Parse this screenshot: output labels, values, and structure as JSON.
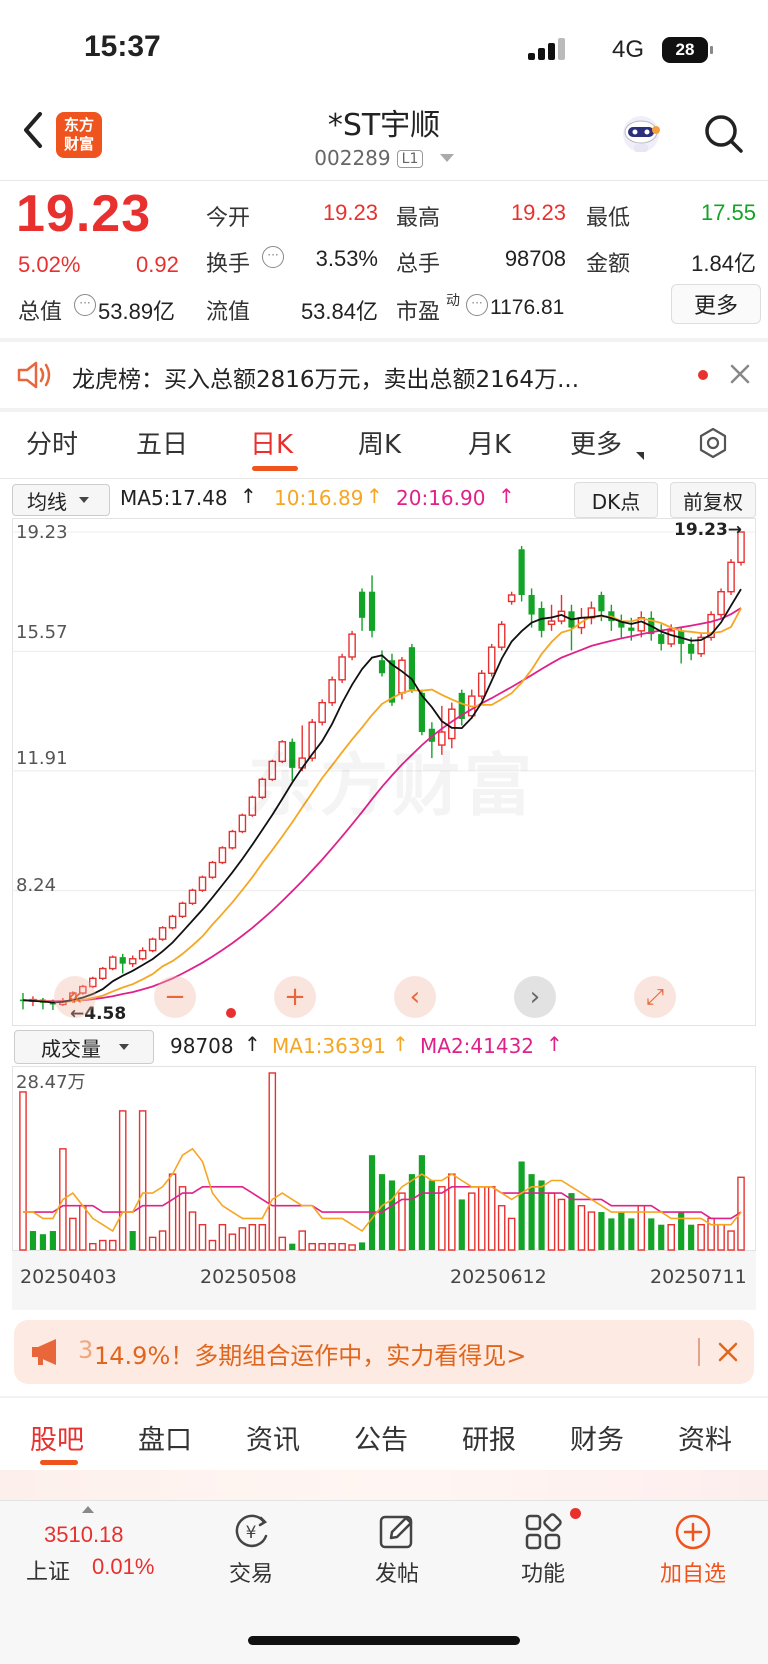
{
  "status_bar": {
    "time": "15:37",
    "network": "4G",
    "battery": "28"
  },
  "header": {
    "title": "*ST宇顺",
    "code": "002289",
    "level": "L1",
    "logo_line1": "东方",
    "logo_line2": "财富"
  },
  "quote": {
    "price": "19.23",
    "change_pct": "5.02%",
    "change_amt": "0.92",
    "open_label": "今开",
    "open": "19.23",
    "high_label": "最高",
    "high": "19.23",
    "low_label": "最低",
    "low": "17.55",
    "turnover_label": "换手",
    "turnover": "3.53%",
    "volume_label": "总手",
    "volume": "98708",
    "amount_label": "金额",
    "amount": "1.84亿",
    "mktcap_label": "总值",
    "mktcap": "53.89亿",
    "float_label": "流值",
    "float_cap": "53.84亿",
    "pe_label": "市盈",
    "pe_sup": "动",
    "pe": "1176.81",
    "more": "更多"
  },
  "notice": {
    "text": "龙虎榜：买入总额2816万元，卖出总额2164万..."
  },
  "period_tabs": [
    {
      "label": "分时"
    },
    {
      "label": "五日"
    },
    {
      "label": "日K"
    },
    {
      "label": "周K"
    },
    {
      "label": "月K"
    },
    {
      "label": "更多"
    }
  ],
  "chart_toolbar": {
    "indicator": "均线",
    "ma5": "MA5:17.48",
    "ma10": "10:16.89",
    "ma20": "20:16.90",
    "dk": "DK点",
    "adjust": "前复权"
  },
  "chart_data": [
    {
      "type": "candlestick",
      "y_ticks": [
        "19.23",
        "15.57",
        "11.91",
        "8.24"
      ],
      "ylim": [
        4.58,
        19.23
      ],
      "max_label": "19.23",
      "min_label": "4.58",
      "colors": {
        "up": "#e8312f",
        "down": "#13a327",
        "ma5": "#111111",
        "ma10": "#f5a623",
        "ma20": "#e0218a"
      },
      "candles": [
        [
          4.9,
          4.85,
          5.1,
          4.6
        ],
        [
          4.85,
          4.9,
          5.0,
          4.7
        ],
        [
          4.9,
          4.8,
          4.95,
          4.6
        ],
        [
          4.8,
          4.75,
          4.9,
          4.58
        ],
        [
          4.75,
          4.85,
          4.95,
          4.7
        ],
        [
          4.85,
          5.1,
          5.15,
          4.8
        ],
        [
          5.1,
          5.3,
          5.35,
          5.05
        ],
        [
          5.3,
          5.55,
          5.6,
          5.25
        ],
        [
          5.55,
          5.85,
          5.9,
          5.5
        ],
        [
          5.85,
          6.2,
          6.25,
          5.8
        ],
        [
          6.2,
          6.0,
          6.3,
          5.7
        ],
        [
          6.0,
          6.15,
          6.25,
          5.9
        ],
        [
          6.15,
          6.4,
          6.5,
          6.1
        ],
        [
          6.4,
          6.75,
          6.8,
          6.35
        ],
        [
          6.75,
          7.1,
          7.15,
          6.7
        ],
        [
          7.1,
          7.45,
          7.5,
          7.05
        ],
        [
          7.45,
          7.85,
          7.9,
          7.4
        ],
        [
          7.85,
          8.25,
          8.3,
          7.8
        ],
        [
          8.25,
          8.65,
          8.7,
          8.2
        ],
        [
          8.65,
          9.1,
          9.15,
          8.6
        ],
        [
          9.1,
          9.55,
          9.6,
          9.05
        ],
        [
          9.55,
          10.05,
          10.1,
          9.5
        ],
        [
          10.05,
          10.55,
          10.6,
          10.0
        ],
        [
          10.55,
          11.1,
          11.15,
          10.5
        ],
        [
          11.1,
          11.65,
          11.7,
          11.05
        ],
        [
          11.65,
          12.2,
          12.25,
          11.6
        ],
        [
          12.2,
          12.8,
          12.85,
          12.15
        ],
        [
          12.8,
          12.0,
          12.9,
          11.6
        ],
        [
          12.0,
          12.3,
          13.3,
          11.9
        ],
        [
          12.3,
          13.4,
          13.5,
          12.2
        ],
        [
          13.4,
          14.0,
          14.1,
          13.3
        ],
        [
          14.0,
          14.7,
          14.8,
          13.9
        ],
        [
          14.7,
          15.4,
          15.5,
          14.6
        ],
        [
          15.4,
          16.1,
          16.2,
          15.3
        ],
        [
          17.4,
          16.6,
          17.5,
          16.2
        ],
        [
          17.4,
          16.2,
          17.9,
          16.0
        ],
        [
          15.3,
          14.9,
          15.6,
          14.8
        ],
        [
          15.3,
          14.0,
          15.5,
          13.9
        ],
        [
          14.3,
          15.3,
          15.4,
          14.1
        ],
        [
          15.7,
          14.4,
          15.8,
          14.3
        ],
        [
          14.3,
          13.1,
          14.4,
          13.0
        ],
        [
          13.2,
          12.8,
          13.4,
          12.3
        ],
        [
          12.7,
          13.1,
          13.9,
          12.4
        ],
        [
          12.9,
          13.8,
          14.0,
          12.6
        ],
        [
          14.3,
          13.5,
          14.4,
          13.3
        ],
        [
          13.6,
          14.2,
          14.4,
          13.5
        ],
        [
          14.2,
          14.9,
          15.0,
          14.1
        ],
        [
          14.9,
          15.7,
          15.8,
          14.8
        ],
        [
          15.7,
          16.4,
          16.5,
          15.6
        ],
        [
          17.1,
          17.3,
          17.4,
          17.0
        ],
        [
          18.7,
          17.3,
          18.8,
          17.1
        ],
        [
          17.3,
          16.7,
          17.5,
          16.3
        ],
        [
          16.9,
          16.2,
          17.1,
          16.0
        ],
        [
          16.4,
          16.5,
          17.0,
          16.2
        ],
        [
          16.5,
          16.8,
          17.3,
          16.4
        ],
        [
          16.8,
          16.3,
          17.0,
          15.6
        ],
        [
          16.3,
          16.6,
          16.9,
          16.1
        ],
        [
          16.6,
          16.9,
          17.1,
          16.4
        ],
        [
          17.3,
          16.8,
          17.4,
          16.5
        ],
        [
          16.8,
          16.5,
          17.0,
          16.2
        ],
        [
          16.5,
          16.3,
          16.7,
          16.0
        ],
        [
          16.3,
          16.2,
          16.6,
          15.9
        ],
        [
          16.2,
          16.6,
          16.8,
          16.0
        ],
        [
          16.6,
          16.1,
          16.8,
          15.9
        ],
        [
          16.1,
          15.8,
          16.4,
          15.6
        ],
        [
          15.8,
          16.2,
          16.4,
          15.7
        ],
        [
          16.2,
          15.8,
          16.3,
          15.2
        ],
        [
          15.8,
          15.5,
          16.0,
          15.3
        ],
        [
          15.5,
          16.0,
          16.1,
          15.4
        ],
        [
          16.0,
          16.7,
          16.8,
          15.9
        ],
        [
          16.7,
          17.4,
          17.5,
          16.6
        ],
        [
          17.4,
          18.3,
          18.4,
          17.3
        ],
        [
          18.3,
          19.23,
          19.23,
          18.2
        ]
      ],
      "ma5": [
        4.88,
        4.86,
        4.84,
        4.81,
        4.83,
        4.89,
        4.96,
        5.07,
        5.22,
        5.46,
        5.63,
        5.78,
        5.96,
        6.14,
        6.38,
        6.65,
        6.98,
        7.32,
        7.66,
        8.03,
        8.41,
        8.8,
        9.21,
        9.65,
        10.1,
        10.56,
        11.05,
        11.55,
        12.0,
        12.42,
        12.82,
        13.35,
        13.99,
        14.55,
        15.03,
        15.38,
        15.45,
        15.17,
        14.96,
        14.72,
        14.22,
        13.86,
        13.43,
        13.23,
        13.22,
        13.54,
        14.0,
        14.67,
        15.35,
        15.87,
        16.19,
        16.45,
        16.57,
        16.61,
        16.69,
        16.55,
        16.6,
        16.62,
        16.67,
        16.59,
        16.48,
        16.41,
        16.49,
        16.35,
        16.18,
        16.07,
        15.99,
        15.9,
        15.92,
        16.09,
        16.46,
        16.97,
        17.48
      ],
      "ma10": [
        4.88,
        4.87,
        4.85,
        4.83,
        4.83,
        4.85,
        4.89,
        4.95,
        5.02,
        5.15,
        5.27,
        5.37,
        5.52,
        5.68,
        5.92,
        6.08,
        6.3,
        6.56,
        6.84,
        7.2,
        7.53,
        7.88,
        8.26,
        8.65,
        9.08,
        9.48,
        9.9,
        10.33,
        10.79,
        11.24,
        11.69,
        12.08,
        12.48,
        12.87,
        13.24,
        13.62,
        13.96,
        14.14,
        14.3,
        14.38,
        14.37,
        14.4,
        14.24,
        14.1,
        13.97,
        13.88,
        13.93,
        13.93,
        14.11,
        14.29,
        14.61,
        15.01,
        15.49,
        15.86,
        16.15,
        16.24,
        16.47,
        16.64,
        16.64,
        16.64,
        16.5,
        16.49,
        16.58,
        16.52,
        16.44,
        16.3,
        16.2,
        16.17,
        16.13,
        16.13,
        16.17,
        16.32,
        16.89
      ],
      "ma20": [
        4.88,
        4.87,
        4.86,
        4.85,
        4.85,
        4.86,
        4.88,
        4.91,
        4.95,
        5.0,
        5.07,
        5.13,
        5.21,
        5.3,
        5.42,
        5.55,
        5.7,
        5.86,
        6.03,
        6.22,
        6.42,
        6.63,
        6.86,
        7.1,
        7.36,
        7.63,
        7.92,
        8.22,
        8.53,
        8.86,
        9.19,
        9.54,
        9.9,
        10.27,
        10.65,
        11.04,
        11.42,
        11.77,
        12.1,
        12.4,
        12.7,
        12.97,
        13.2,
        13.42,
        13.62,
        13.8,
        13.98,
        14.14,
        14.31,
        14.48,
        14.66,
        14.84,
        15.03,
        15.21,
        15.38,
        15.5,
        15.62,
        15.74,
        15.82,
        15.9,
        15.97,
        16.03,
        16.1,
        16.16,
        16.21,
        16.26,
        16.31,
        16.36,
        16.42,
        16.48,
        16.57,
        16.71,
        16.9
      ]
    },
    {
      "type": "bar",
      "label": "成交量",
      "vol": "98708",
      "ma1": "MA1:36391",
      "ma2": "MA2:41432",
      "y_top_label": "28.47万",
      "ymax": 28.47,
      "x_labels": [
        "20250403",
        "20250508",
        "20250612",
        "20250711"
      ],
      "volumes": [
        25,
        3,
        2.5,
        3,
        16,
        5,
        7,
        1,
        1.5,
        1.5,
        22,
        3,
        22,
        2,
        3,
        12,
        10,
        6,
        4,
        1.5,
        4,
        2.5,
        3.5,
        4,
        4,
        28,
        2,
        1,
        3,
        1,
        1,
        1,
        1,
        0.8,
        1.2,
        15,
        12,
        11,
        9,
        12,
        15,
        11,
        10,
        12,
        8,
        9,
        10,
        10,
        7,
        5,
        14,
        12,
        11,
        9,
        8,
        9,
        7,
        6,
        6,
        5,
        6,
        5,
        7,
        5,
        4,
        4,
        6,
        4,
        4,
        5,
        4,
        3,
        11.5
      ],
      "directions": [
        1,
        -1,
        -1,
        -1,
        1,
        1,
        1,
        1,
        1,
        1,
        1,
        -1,
        1,
        1,
        1,
        1,
        1,
        1,
        1,
        1,
        1,
        1,
        1,
        1,
        1,
        1,
        1,
        -1,
        1,
        1,
        1,
        1,
        1,
        1,
        -1,
        -1,
        -1,
        -1,
        1,
        -1,
        -1,
        -1,
        1,
        1,
        -1,
        1,
        1,
        1,
        1,
        1,
        -1,
        -1,
        -1,
        1,
        1,
        -1,
        1,
        1,
        -1,
        -1,
        -1,
        -1,
        1,
        -1,
        -1,
        1,
        -1,
        -1,
        1,
        1,
        1,
        1,
        1
      ],
      "ma1_line": [
        6,
        6,
        5,
        5,
        8,
        9,
        7,
        5,
        4,
        3,
        6,
        6,
        9,
        9,
        10,
        12,
        15,
        16,
        14,
        9,
        7,
        6,
        5,
        5,
        5,
        8,
        9,
        8,
        7,
        7,
        5,
        5,
        5,
        4,
        3,
        5,
        7,
        8,
        10,
        11,
        12,
        11,
        11,
        12,
        11,
        10,
        10,
        10,
        9,
        8,
        9,
        10,
        10,
        11,
        11,
        10,
        9,
        8,
        7,
        6,
        6,
        6,
        6,
        6,
        6,
        5,
        5,
        5,
        5,
        4,
        4,
        4,
        6
      ],
      "ma2_line": [
        6,
        6,
        6,
        6,
        7,
        7,
        7,
        7,
        6,
        6,
        6,
        6,
        7,
        7,
        7,
        8,
        9,
        9,
        10,
        10,
        10,
        10,
        10,
        9,
        8,
        7,
        7,
        7,
        7,
        7,
        6,
        6,
        6,
        6,
        6,
        6,
        6,
        7,
        8,
        8,
        9,
        9,
        9,
        10,
        10,
        10,
        10,
        10,
        9,
        9,
        9,
        9,
        9,
        9,
        9,
        8,
        8,
        8,
        8,
        7,
        7,
        7,
        7,
        7,
        6,
        6,
        6,
        6,
        6,
        5,
        5,
        5,
        6
      ]
    }
  ],
  "chart_controls": {
    "fast_back": "«",
    "zoom_out": "−",
    "zoom_in": "+",
    "prev": "‹",
    "next": "›",
    "fullscreen": "⤢"
  },
  "promo": {
    "text": "14.9%！多期组合运作中，实力看得见>",
    "prefix": "3"
  },
  "content_tabs": [
    {
      "label": "股吧"
    },
    {
      "label": "盘口"
    },
    {
      "label": "资讯"
    },
    {
      "label": "公告"
    },
    {
      "label": "研报"
    },
    {
      "label": "财务"
    },
    {
      "label": "资料"
    }
  ],
  "bottom_nav": {
    "index_value": "3510.18",
    "index_name": "上证",
    "index_change": "0.01%",
    "items": [
      {
        "label": "交易"
      },
      {
        "label": "发帖"
      },
      {
        "label": "功能"
      },
      {
        "label": "加自选"
      }
    ]
  }
}
